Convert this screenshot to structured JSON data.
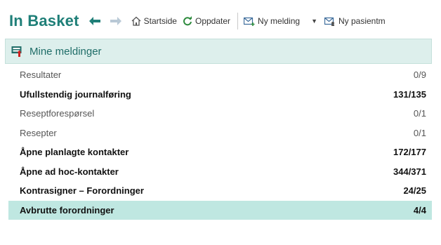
{
  "toolbar": {
    "title": "In Basket",
    "startside": "Startside",
    "oppdater": "Oppdater",
    "ny_melding": "Ny melding",
    "ny_pasient": "Ny pasientm"
  },
  "panel": {
    "title": "Mine meldinger"
  },
  "rows": [
    {
      "label": "Resultater",
      "count": "0/9",
      "bold": false
    },
    {
      "label": "Ufullstendig journalføring",
      "count": "131/135",
      "bold": true
    },
    {
      "label": "Reseptforespørsel",
      "count": "0/1",
      "bold": false
    },
    {
      "label": "Resepter",
      "count": "0/1",
      "bold": false
    },
    {
      "label": "Åpne planlagte kontakter",
      "count": "172/177",
      "bold": true
    },
    {
      "label": "Åpne ad hoc-kontakter",
      "count": "344/371",
      "bold": true
    },
    {
      "label": "Kontrasigner – Forordninger",
      "count": "24/25",
      "bold": true
    },
    {
      "label": "Avbrutte forordninger",
      "count": "4/4",
      "bold": true
    }
  ],
  "colors": {
    "accent": "#1f7f78",
    "header_bg": "#ddefec",
    "selected_bg": "#bfe7e1"
  }
}
